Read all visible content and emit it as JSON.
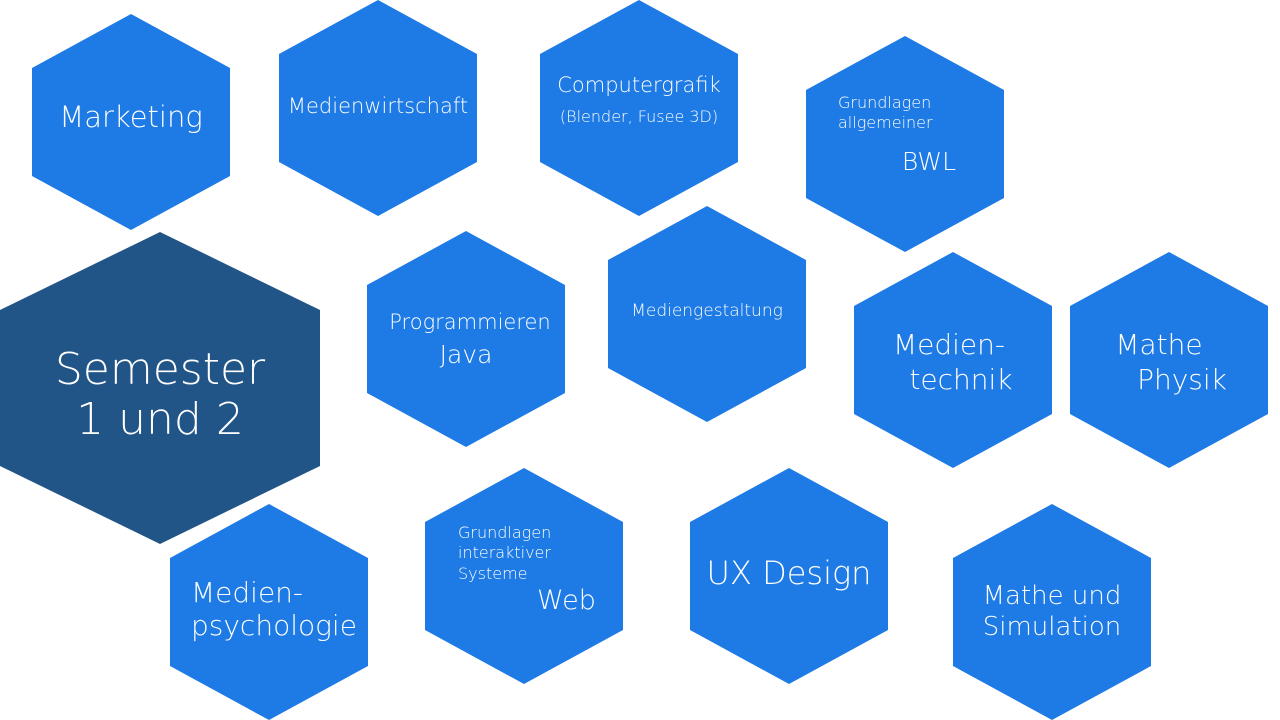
{
  "center": {
    "line1": "Semester",
    "line2": "1 und 2"
  },
  "modules": {
    "marketing": "Marketing",
    "medienwirtschaft": "Medienwirtschaft",
    "computergrafik": {
      "title": "Computergrafik",
      "subtitle": "(Blender, Fusee 3D)"
    },
    "bwl": {
      "line1": "Grundlagen",
      "line2": "allgemeiner",
      "line3": "BWL"
    },
    "programmieren": {
      "line1": "Programmieren",
      "line2": "Java"
    },
    "mediengestaltung": "Mediengestaltung",
    "medientechnik": {
      "line1": "Medien-",
      "line2": "technik"
    },
    "mathe_physik": {
      "line1": "Mathe",
      "line2": "Physik"
    },
    "medienpsychologie": {
      "line1": "Medien-",
      "line2": "psychologie"
    },
    "web": {
      "line1": "Grundlagen",
      "line2": "interaktiver",
      "line3": "Systeme",
      "line4": "Web"
    },
    "ux_design": "UX Design",
    "mathe_simulation": {
      "line1": "Mathe und",
      "line2": "Simulation"
    }
  },
  "colors": {
    "module_hex": "#1e7ae4",
    "center_hex": "#225587",
    "text": "#ffffff"
  }
}
